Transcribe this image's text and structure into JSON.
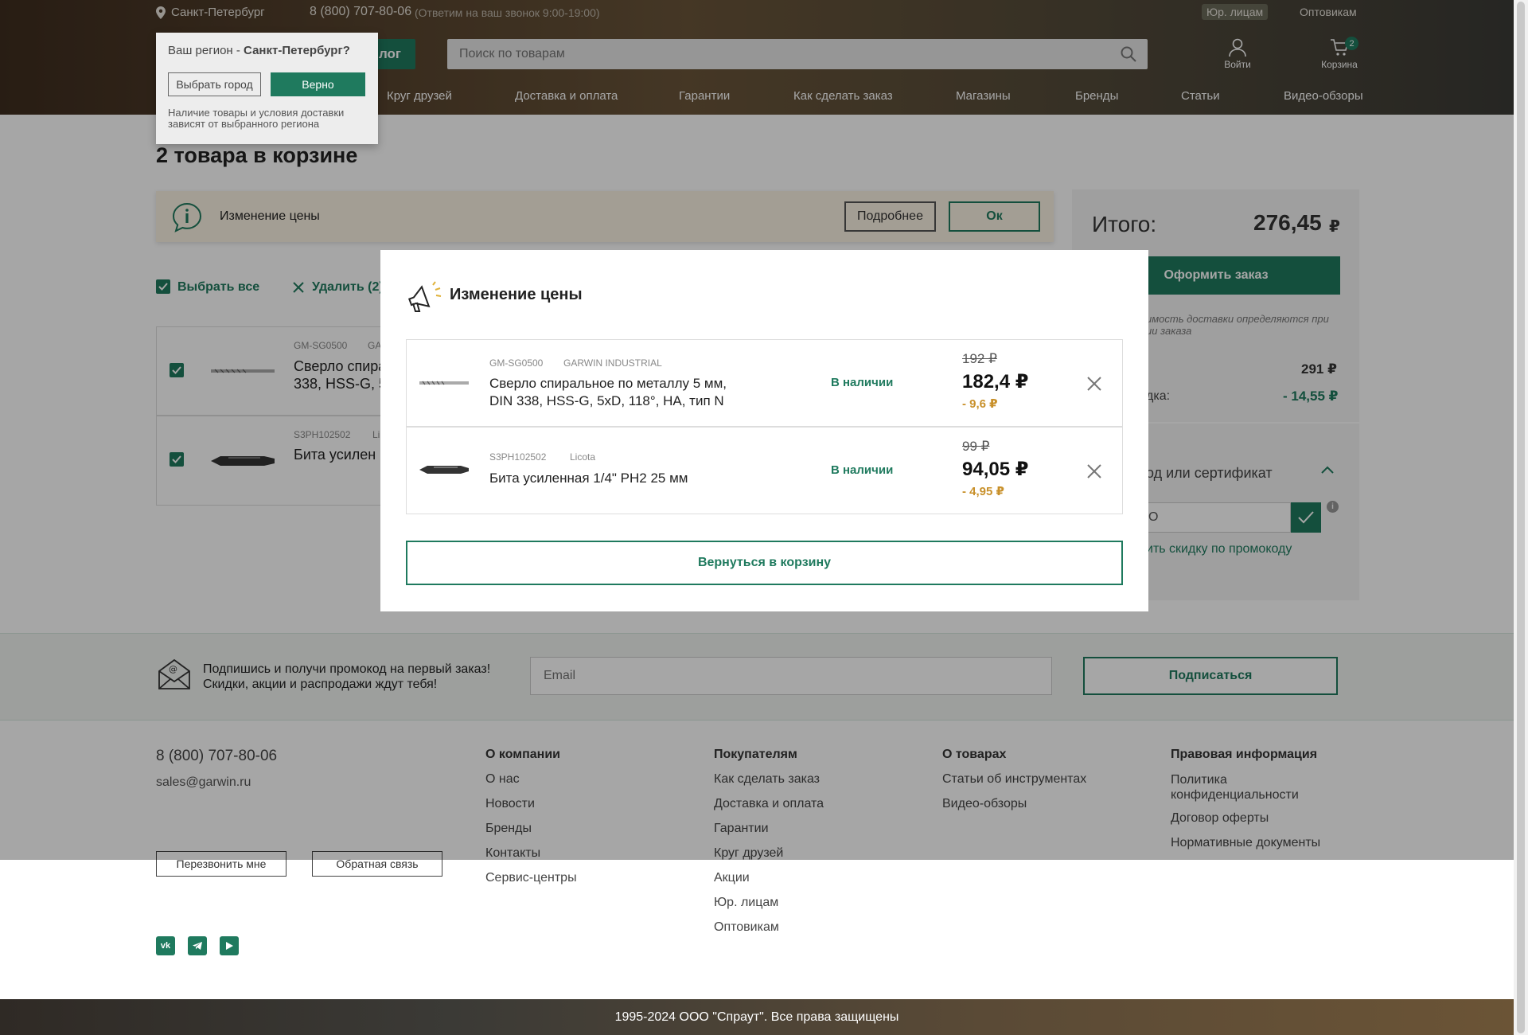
{
  "header": {
    "city": "Санкт-Петербург",
    "phone": "8 (800) 707-80-06",
    "phone_note": "(Ответим на ваш звонок 9:00-19:00)",
    "legal": "Юр. лицам",
    "wholesale": "Оптовикам",
    "catalog": "лог",
    "search_placeholder": "Поиск по товарам",
    "login": "Войти",
    "cart": "Корзина",
    "cart_count": "2",
    "nav": [
      "Круг друзей",
      "Доставка и оплата",
      "Гарантии",
      "Как сделать заказ",
      "Магазины",
      "Бренды",
      "Статьи",
      "Видео-обзоры"
    ]
  },
  "region_popup": {
    "question_prefix": "Ваш регион - ",
    "question_city": "Санкт-Петербург?",
    "choose_city": "Выбрать город",
    "confirm": "Верно",
    "note": "Наличие товары и условия доставки зависят от выбранного региона"
  },
  "cart": {
    "title": "2 товара в корзине",
    "notice": {
      "text": "Изменение цены",
      "more": "Подробнее",
      "ok": "Ок"
    },
    "select_all": "Выбрать все",
    "delete": "Удалить (2)",
    "items": [
      {
        "sku": "GM-SG0500",
        "brand_short": "GA",
        "name_line1": "Сверло спира",
        "name_line2": "338, HSS-G, 5"
      },
      {
        "sku": "S3PH102502",
        "brand_short": "Li",
        "name_line1": "Бита усилен",
        "name_line2": ""
      }
    ]
  },
  "summary": {
    "total_label": "Итого:",
    "total_value": "276,45",
    "currency": "₽",
    "checkout": "Оформить заказ",
    "delivery_note_1": "имость доставки определяются при",
    "delivery_note_2": "ии заказа",
    "subtotal": "291 ₽",
    "discount_label": "дка:",
    "discount_value": "- 14,55 ₽",
    "promo_title": "од или сертификат",
    "promo_value": "О",
    "promo_link": "ить скидку по промокоду"
  },
  "modal": {
    "title": "Изменение цены",
    "items": [
      {
        "sku": "GM-SG0500",
        "brand": "GARWIN INDUSTRIAL",
        "name_line1": "Сверло спиральное по металлу 5 мм,",
        "name_line2": "DIN 338, HSS-G, 5xD, 118°, HA, тип N",
        "stock": "В наличии",
        "old_price": "192 ₽",
        "new_price": "182,4 ₽",
        "diff": "- 9,6 ₽"
      },
      {
        "sku": "S3PH102502",
        "brand": "Licota",
        "name_line1": "Бита усиленная 1/4\" PH2 25 мм",
        "name_line2": "",
        "stock": "В наличии",
        "old_price": "99 ₽",
        "new_price": "94,05 ₽",
        "diff": "- 4,95 ₽"
      }
    ],
    "back_button": "Вернуться в корзину"
  },
  "subscribe": {
    "line1": "Подпишись и получи промокод на первый заказ!",
    "line2": "Скидки, акции и распродажи ждут тебя!",
    "email_placeholder": "Email",
    "button": "Подписаться"
  },
  "footer": {
    "phone": "8 (800) 707-80-06",
    "email": "sales@garwin.ru",
    "callback": "Перезвонить мне",
    "feedback": "Обратная связь",
    "col1": {
      "title": "О компании",
      "links": [
        "О нас",
        "Новости",
        "Бренды",
        "Контакты",
        "Сервис-центры"
      ]
    },
    "col2": {
      "title": "Покупателям",
      "links": [
        "Как сделать заказ",
        "Доставка и оплата",
        "Гарантии",
        "Круг друзей",
        "Акции",
        "Юр. лицам",
        "Оптовикам"
      ]
    },
    "col3": {
      "title": "О товарах",
      "links": [
        "Статьи об инструментах",
        "Видео-обзоры"
      ]
    },
    "col4": {
      "title": "Правовая информация",
      "links": [
        "Политика конфиденциальности",
        "Договор оферты",
        "Нормативные документы"
      ]
    },
    "social": [
      "vk-icon",
      "telegram-icon",
      "youtube-icon"
    ],
    "copyright": "1995-2024 ООО \"Спраут\". Все права защищены"
  },
  "colors": {
    "accent": "#1f7a5e",
    "discount": "#c8902a"
  }
}
